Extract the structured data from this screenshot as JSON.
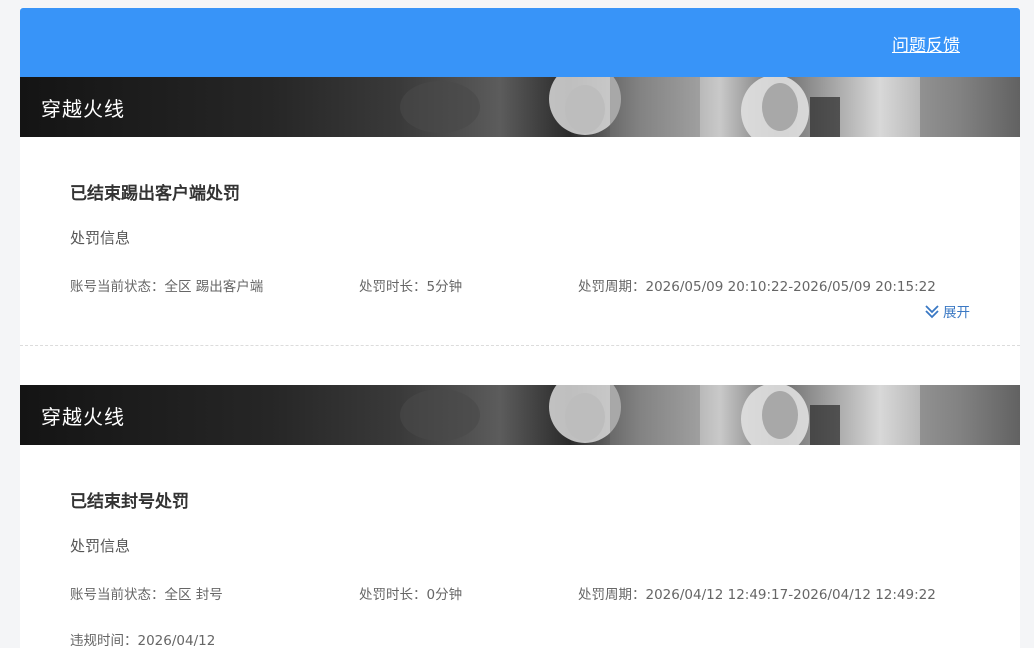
{
  "header": {
    "feedback_label": "问题反馈"
  },
  "cards": [
    {
      "game": "穿越火线",
      "status_title": "已结束踢出客户端处罚",
      "section_label": "处罚信息",
      "account_status": "账号当前状态：全区 踢出客户端",
      "duration": "处罚时长：5分钟",
      "period": "处罚周期：2026/05/09 20:10:22-2026/05/09 20:15:22",
      "expand_label": "展开"
    },
    {
      "game": "穿越火线",
      "status_title": "已结束封号处罚",
      "section_label": "处罚信息",
      "account_status": "账号当前状态：全区 封号",
      "duration": "处罚时长：0分钟",
      "period": "处罚周期：2026/04/12 12:49:17-2026/04/12 12:49:22",
      "partial_line": "违规时间：2026/04/12"
    }
  ],
  "colors": {
    "accent": "#3894f8",
    "link": "#3a78c4"
  }
}
